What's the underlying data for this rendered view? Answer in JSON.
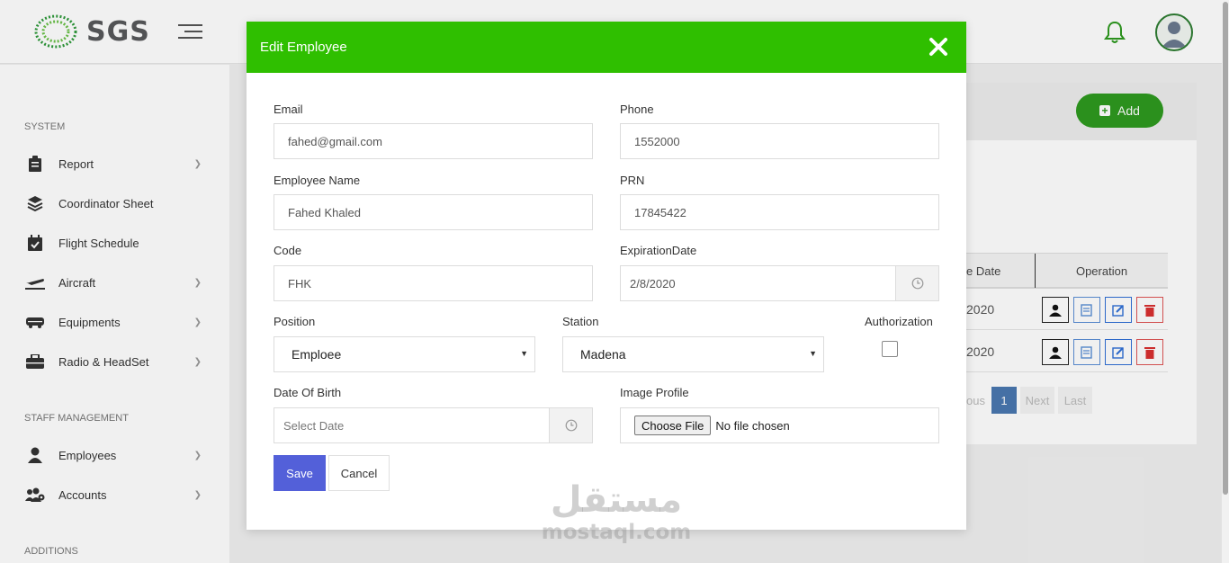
{
  "app": {
    "brand": "SGS"
  },
  "sidebar": {
    "sections": [
      {
        "label": "SYSTEM"
      },
      {
        "label": "STAFF MANAGEMENT"
      },
      {
        "label": "ADDITIONS"
      }
    ],
    "items": [
      {
        "label": "Report",
        "icon": "clipboard-icon",
        "has_submenu": true
      },
      {
        "label": "Coordinator Sheet",
        "icon": "layers-icon",
        "has_submenu": false
      },
      {
        "label": "Flight Schedule",
        "icon": "calendar-check-icon",
        "has_submenu": false
      },
      {
        "label": "Aircraft",
        "icon": "plane-icon",
        "has_submenu": true
      },
      {
        "label": "Equipments",
        "icon": "truck-icon",
        "has_submenu": true
      },
      {
        "label": "Radio & HeadSet",
        "icon": "toolbox-icon",
        "has_submenu": true
      },
      {
        "label": "Employees",
        "icon": "user-icon",
        "has_submenu": true
      },
      {
        "label": "Accounts",
        "icon": "users-gear-icon",
        "has_submenu": true
      }
    ]
  },
  "content": {
    "add_label": "Add",
    "table": {
      "columns": [
        "e Date",
        "Operation"
      ],
      "rows": [
        {
          "date": "2020"
        },
        {
          "date": "2020"
        }
      ]
    },
    "pager": {
      "prev": "ous",
      "current": "1",
      "next": "Next",
      "last": "Last"
    }
  },
  "modal": {
    "title": "Edit Employee",
    "fields": {
      "email": {
        "label": "Email",
        "value": "fahed@gmail.com"
      },
      "phone": {
        "label": "Phone",
        "value": "1552000"
      },
      "name": {
        "label": "Employee Name",
        "value": "Fahed Khaled"
      },
      "prn": {
        "label": "PRN",
        "value": "17845422"
      },
      "code": {
        "label": "Code",
        "value": "FHK"
      },
      "expiration": {
        "label": "ExpirationDate",
        "value": "2/8/2020"
      },
      "position": {
        "label": "Position",
        "value": "Emploee"
      },
      "station": {
        "label": "Station",
        "value": "Madena"
      },
      "authorization": {
        "label": "Authorization",
        "checked": false
      },
      "dob": {
        "label": "Date Of Birth",
        "placeholder": "Select Date"
      },
      "image": {
        "label": "Image Profile",
        "button": "Choose File",
        "status": "No file chosen"
      }
    },
    "save_label": "Save",
    "cancel_label": "Cancel"
  },
  "watermark": {
    "arabic": "مستقل",
    "latin": "mostaql.com"
  },
  "colors": {
    "header_green": "#2fbf00",
    "save_blue": "#5360d9",
    "add_green": "#2e9a1f"
  }
}
